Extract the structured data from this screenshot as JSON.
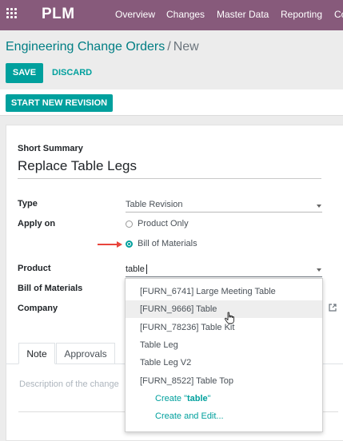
{
  "navbar": {
    "brand": "PLM",
    "menu": [
      "Overview",
      "Changes",
      "Master Data",
      "Reporting",
      "Co"
    ]
  },
  "breadcrumb": {
    "parent": "Engineering Change Orders",
    "separator": "/",
    "current": "New"
  },
  "buttons": {
    "save": "SAVE",
    "discard": "DISCARD",
    "start_revision": "START NEW REVISION"
  },
  "form": {
    "short_summary_label": "Short Summary",
    "short_summary_value": "Replace Table Legs",
    "type_label": "Type",
    "type_value": "Table Revision",
    "apply_on_label": "Apply on",
    "apply_on_options": [
      "Product Only",
      "Bill of Materials"
    ],
    "apply_on_selected": "Bill of Materials",
    "product_label": "Product",
    "product_value": "table",
    "bom_label": "Bill of Materials",
    "company_label": "Company"
  },
  "tabs": [
    "Note",
    "Approvals"
  ],
  "note_placeholder": "Description of the change",
  "autocomplete": {
    "items": [
      "[FURN_6741] Large Meeting Table",
      "[FURN_9666] Table",
      "[FURN_78236] Table Kit",
      "Table Leg",
      "Table Leg V2",
      "[FURN_8522] Table Top"
    ],
    "hovered": "[FURN_9666] Table",
    "create_prefix": "Create \"",
    "create_term": "table",
    "create_suffix": "\"",
    "create_and_edit": "Create and Edit..."
  },
  "colors": {
    "navbar": "#875a7b",
    "primary": "#00a09d",
    "link": "#017e84",
    "annotation_arrow": "#e8453c"
  },
  "icons": [
    "apps-grid-icon",
    "dropdown-caret-icon",
    "radio-icon",
    "external-link-icon",
    "hand-pointer-icon",
    "red-arrow-icon"
  ]
}
